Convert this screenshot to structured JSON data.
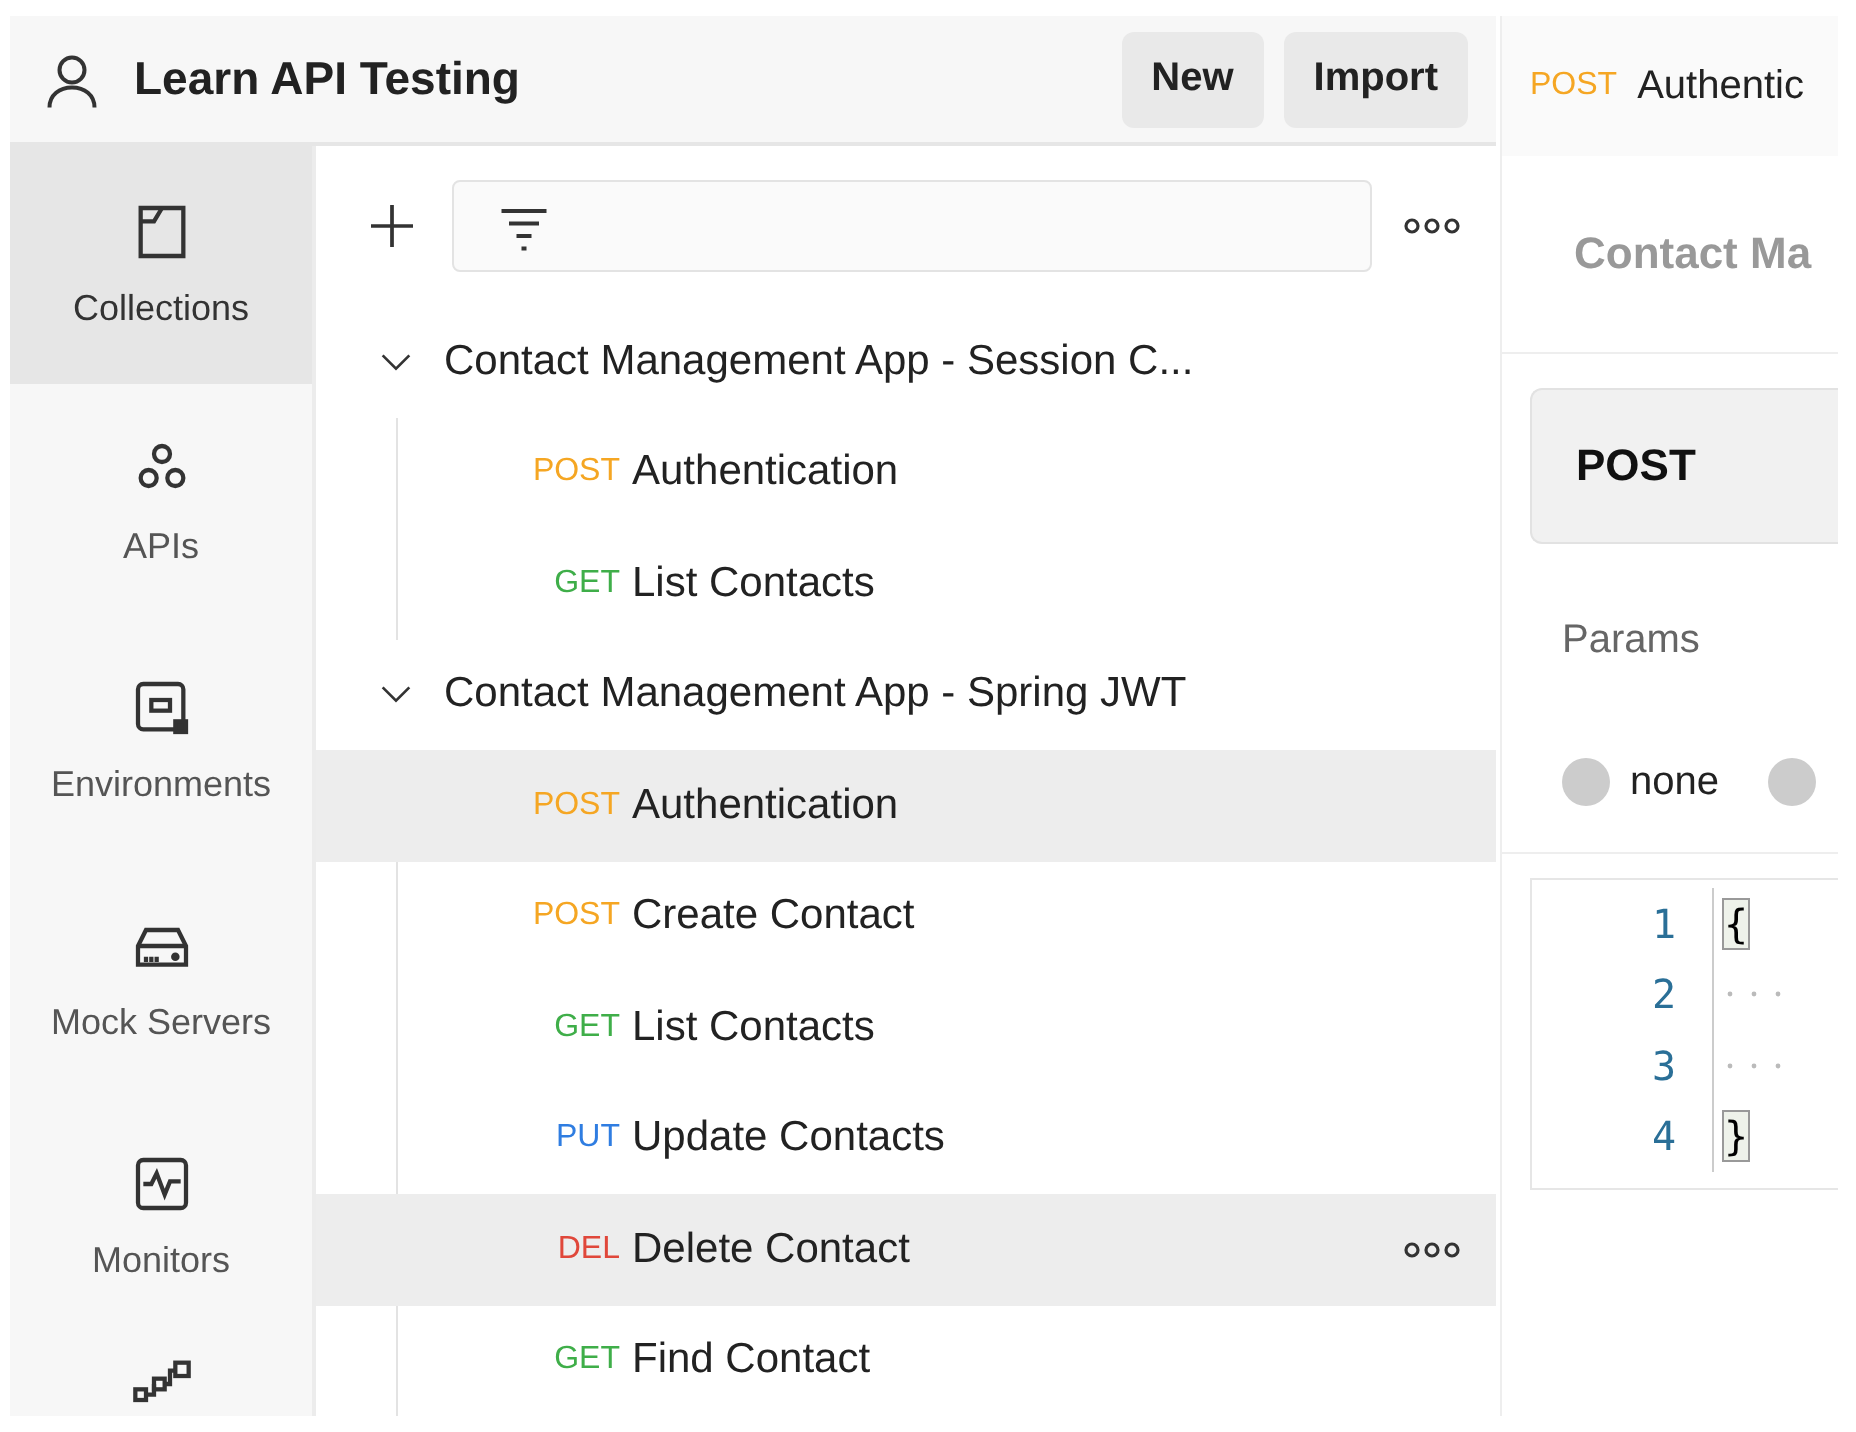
{
  "workspace": {
    "title": "Learn API Testing",
    "buttons": [
      "New",
      "Import"
    ]
  },
  "sidebar": {
    "items": [
      {
        "label": "Collections",
        "selected": true
      },
      {
        "label": "APIs",
        "selected": false
      },
      {
        "label": "Environments",
        "selected": false
      },
      {
        "label": "Mock Servers",
        "selected": false
      },
      {
        "label": "Monitors",
        "selected": false
      },
      {
        "selected": false
      }
    ]
  },
  "collections": [
    {
      "name": "Contact Management App - Session C...",
      "expanded": true,
      "requests": [
        {
          "method": "POST",
          "color": "#f5a623",
          "name": "Authentication",
          "selected": false,
          "hovered": false
        },
        {
          "method": "GET",
          "color": "#3fae49",
          "name": "List Contacts",
          "selected": false,
          "hovered": false
        }
      ]
    },
    {
      "name": "Contact Management App - Spring JWT",
      "expanded": true,
      "requests": [
        {
          "method": "POST",
          "color": "#f5a623",
          "name": "Authentication",
          "selected": true,
          "hovered": false
        },
        {
          "method": "POST",
          "color": "#f5a623",
          "name": "Create Contact",
          "selected": false,
          "hovered": false
        },
        {
          "method": "GET",
          "color": "#3fae49",
          "name": "List Contacts",
          "selected": false,
          "hovered": false
        },
        {
          "method": "PUT",
          "color": "#2f7de1",
          "name": "Update Contacts",
          "selected": false,
          "hovered": false
        },
        {
          "method": "DEL",
          "color": "#e0473a",
          "name": "Delete Contact",
          "selected": true,
          "hovered": true
        },
        {
          "method": "GET",
          "color": "#3fae49",
          "name": "Find Contact",
          "selected": false,
          "hovered": false
        }
      ]
    }
  ],
  "request": {
    "tab": {
      "method": "POST",
      "name": "Authentic"
    },
    "breadcrumb": "Contact Ma",
    "method": "POST",
    "tabs": [
      "Params"
    ],
    "body_options": [
      {
        "label": "none",
        "selected": false
      },
      {
        "selected": false
      }
    ],
    "editor": {
      "lines": [
        {
          "number": "1",
          "text": "{"
        },
        {
          "number": "2"
        },
        {
          "number": "3"
        },
        {
          "number": "4",
          "text": "}"
        }
      ]
    }
  }
}
